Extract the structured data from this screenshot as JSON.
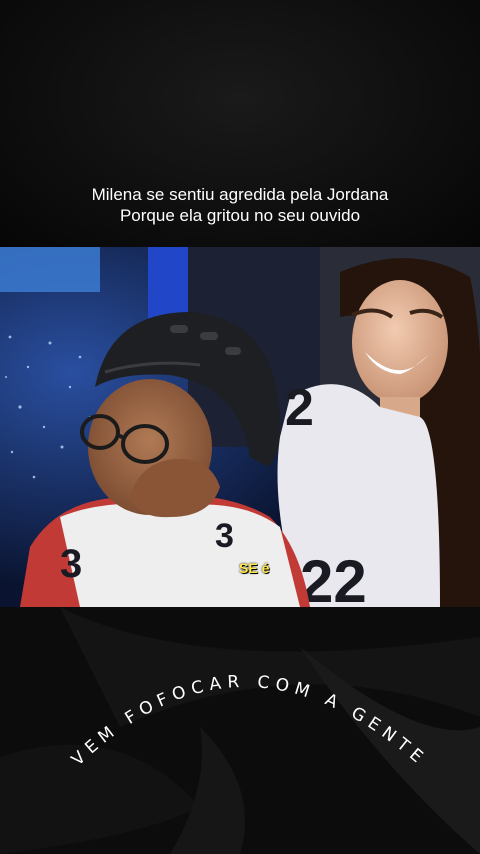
{
  "caption": {
    "line1": "Milena se sentiu agredida pela Jordana",
    "line2": "Porque ela gritou no seu ouvido"
  },
  "video": {
    "subtitle": "SE é"
  },
  "watermark": {
    "text": "VEM FOFOCAR COM A GENTE"
  }
}
